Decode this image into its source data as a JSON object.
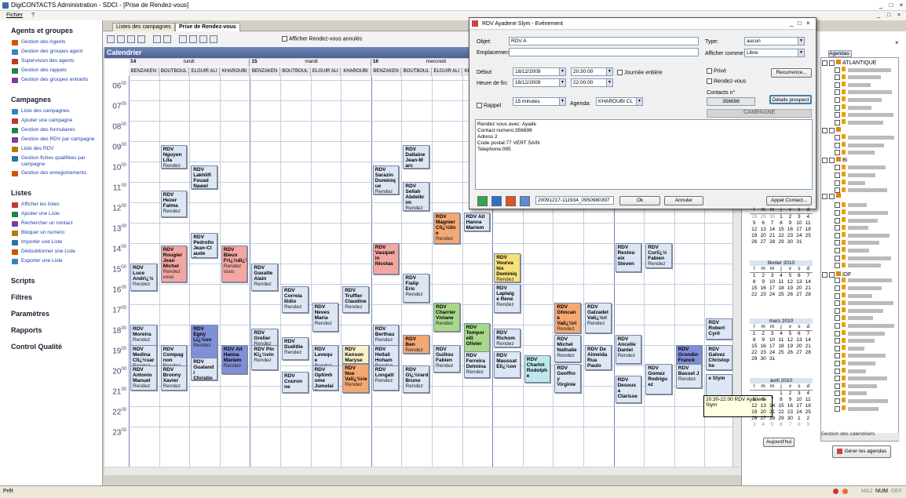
{
  "window": {
    "title": "DigiCONTACTS Administration - SDCI - [Prise de Rendez-vous]"
  },
  "menu": {
    "file": "Fichier",
    "help": "?"
  },
  "sidebar": {
    "sections": [
      {
        "title": "Agents et groupes",
        "items": [
          "Gestion des Agents",
          "Gestion des groupes agent",
          "Supervision des agents",
          "Gestion des rappels",
          "Gestion des groupes entrants"
        ]
      },
      {
        "title": "Campagnes",
        "items": [
          "Liste des campagnes",
          "Ajouter une campagne",
          "Gestion des formulaires",
          "Gestion des RDV par campagne",
          "Liste des RDV",
          "Gestion fiches qualifiées par campagne",
          "Gestion des enregistrements"
        ]
      },
      {
        "title": "Listes",
        "items": [
          "Afficher les listes",
          "Ajouter une Liste",
          "Rechercher un contact",
          "Bloquer un numéro",
          "Importer une Liste",
          "Dédoublonner une Liste",
          "Exporter une Liste"
        ]
      }
    ],
    "other": [
      "Scripts",
      "Filtres",
      "Paramètres",
      "Rapports",
      "Control Qualité"
    ]
  },
  "tabs": [
    "Listes des campagnes",
    "Prise de Rendez-vous"
  ],
  "toolbar": {
    "show_cancelled": "Afficher Rendez-vous annulés"
  },
  "calendar": {
    "title": "Calendrier",
    "days": [
      {
        "num": "14",
        "name": "lundi"
      },
      {
        "num": "15",
        "name": "mardi"
      },
      {
        "num": "16",
        "name": "mercredi"
      }
    ],
    "agents": [
      "BENZAKEN",
      "BOUTBOUL",
      "ELGUIR ALI",
      "KHAROUBI",
      "BENZAKEN",
      "BOUTBOUL",
      "ELGUIR ALI",
      "KHAROUBI",
      "BENZAKEN",
      "BOUTBOUL",
      "ELGUIR ALI",
      "KHAROUBI",
      "",
      "",
      "",
      "",
      "",
      "",
      ""
    ],
    "hours": [
      "06",
      "07",
      "08",
      "09",
      "10",
      "11",
      "12",
      "13",
      "14",
      "15",
      "16",
      "17",
      "18",
      "19",
      "20",
      "21",
      "22",
      "23"
    ],
    "events": [
      {
        "c": 1,
        "h": 9.0,
        "d": 1.2,
        "t": "RDV Nguyen Lita",
        "s": "Rendez",
        "col": "#dce6f4"
      },
      {
        "c": 2,
        "h": 10.0,
        "d": 1.2,
        "t": "RDV Lakhlifi Fouad Nawel",
        "s": "Rendez",
        "col": "#dce6f4"
      },
      {
        "c": 1,
        "h": 11.2,
        "d": 1.4,
        "t": "RDV Hezer Fatma",
        "s": "Rendez",
        "col": "#dce6f4"
      },
      {
        "c": 2,
        "h": 13.3,
        "d": 1.3,
        "t": "RDV Pedrollo Jean-Cl aude",
        "s": "Rendez",
        "col": "#dce6f4"
      },
      {
        "c": 1,
        "h": 13.9,
        "d": 1.9,
        "t": "RDV Rougier Jean Michel",
        "s": "Rendez vous",
        "col": "#f4a6a0"
      },
      {
        "c": 3,
        "h": 13.9,
        "d": 1.9,
        "t": "RDV Bieux Frï¿½dï¿½ric",
        "s": "Rendez vous",
        "col": "#f4a6a0"
      },
      {
        "c": 0,
        "h": 14.8,
        "d": 1.4,
        "t": "RDV Luce Andrï¿½",
        "s": "Rendez",
        "col": "#dce6f4"
      },
      {
        "c": 4,
        "h": 14.8,
        "d": 1.4,
        "t": "RDV Gaxatte Alain",
        "s": "Rendez",
        "col": "#dce6f4"
      },
      {
        "c": 5,
        "h": 15.9,
        "d": 1.4,
        "t": "RDV Correia Ilidio",
        "s": "Rendez",
        "col": "#dce6f4"
      },
      {
        "c": 7,
        "h": 15.9,
        "d": 1.4,
        "t": "RDV Truffier Claudine",
        "s": "Rendez",
        "col": "#dce6f4"
      },
      {
        "c": 6,
        "h": 16.7,
        "d": 1.5,
        "t": "RDV Neves Maria",
        "s": "Rendez",
        "col": "#dce6f4"
      },
      {
        "c": 0,
        "h": 17.8,
        "d": 1.1,
        "t": "RDV Moreira",
        "s": "Rendez",
        "col": "#dce6f4"
      },
      {
        "c": 2,
        "h": 17.8,
        "d": 1.8,
        "t": "RDV Egny Lï¿½on",
        "s": "Rendez",
        "col": "#7f8fd8"
      },
      {
        "c": 4,
        "h": 18.0,
        "d": 1.0,
        "t": "RDV Grelier",
        "s": "Rendez",
        "col": "#dce6f4"
      },
      {
        "c": 0,
        "h": 18.8,
        "d": 1.3,
        "t": "RDV Medina Clï¿½sar",
        "s": "Rendez",
        "col": "#dce6f4"
      },
      {
        "c": 1,
        "h": 18.8,
        "d": 1.3,
        "t": "RDV Compag non",
        "s": "Rendez",
        "col": "#dce6f4"
      },
      {
        "c": 3,
        "h": 18.8,
        "d": 1.5,
        "t": "RDV Ait Hanna Mariem",
        "s": "Rendez",
        "col": "#7f8fd8"
      },
      {
        "c": 4,
        "h": 18.8,
        "d": 1.3,
        "t": "RDV Pin Kï¿½vin",
        "s": "Rendez",
        "col": "#dce6f4"
      },
      {
        "c": 5,
        "h": 18.4,
        "d": 1.2,
        "t": "RDV Duditlie",
        "s": "Rendez",
        "col": "#dce6f4"
      },
      {
        "c": 2,
        "h": 19.4,
        "d": 1.2,
        "t": "RDV Gualand i Christin",
        "s": "Rendez",
        "col": "#dce6f4"
      },
      {
        "c": 0,
        "h": 19.8,
        "d": 1.3,
        "t": "RDV Antonio Manuel",
        "s": "Rendez",
        "col": "#dce6f4"
      },
      {
        "c": 1,
        "h": 19.8,
        "d": 1.3,
        "t": "RDV Bronny Xavier",
        "s": "Rendez",
        "col": "#dce6f4"
      },
      {
        "c": 5,
        "h": 20.1,
        "d": 1.1,
        "t": "RDV Couron ne",
        "s": "",
        "col": "#dce6f4"
      },
      {
        "c": 6,
        "h": 18.8,
        "d": 1.4,
        "t": "RDV Levequ e",
        "s": "Rendez",
        "col": "#dce6f4"
      },
      {
        "c": 6,
        "h": 19.8,
        "d": 1.3,
        "t": "RDV Optimh ome Jumelai",
        "s": "Rendez",
        "col": "#dce6f4"
      },
      {
        "c": 7,
        "h": 18.8,
        "d": 1.0,
        "t": "RDV Kenson Maryse",
        "s": "",
        "col": "#f7f0c8"
      },
      {
        "c": 7,
        "h": 19.7,
        "d": 1.5,
        "t": "RDV Noe Valï¿½rie",
        "s": "Rendez",
        "col": "#f4a872"
      },
      {
        "c": 8,
        "h": 10.0,
        "d": 1.5,
        "t": "RDV Sarazin Dominiq ue",
        "s": "Rendez",
        "col": "#dce6f4"
      },
      {
        "c": 9,
        "h": 9.0,
        "d": 1.2,
        "t": "RDV Dallaine Jean-M arc",
        "s": "",
        "col": "#dce6f4"
      },
      {
        "c": 9,
        "h": 10.8,
        "d": 1.5,
        "t": "RDV Sellah Abdelkr im",
        "s": "Rendez",
        "col": "#dce6f4"
      },
      {
        "c": 10,
        "h": 12.3,
        "d": 1.6,
        "t": "RDV Magnier Clï¿½lin e",
        "s": "Rendez",
        "col": "#f4a872"
      },
      {
        "c": 11,
        "h": 12.3,
        "d": 1.0,
        "t": "RDV Ait Hanna Mariem",
        "s": "Rendez",
        "col": "#dce6f4"
      },
      {
        "c": 8,
        "h": 13.8,
        "d": 1.6,
        "t": "RDV Vauquel in Nicolas",
        "s": "",
        "col": "#f4a6a0"
      },
      {
        "c": 9,
        "h": 15.3,
        "d": 1.5,
        "t": "RDV Fialip Eric",
        "s": "Rendez",
        "col": "#dce6f4"
      },
      {
        "c": 10,
        "h": 16.7,
        "d": 1.5,
        "t": "RDV Charrier Viviane",
        "s": "Rendez",
        "col": "#a8d88a"
      },
      {
        "c": 11,
        "h": 17.7,
        "d": 1.5,
        "t": "RDV Tempor elli Olivier",
        "s": "",
        "col": "#a8d88a"
      },
      {
        "c": 8,
        "h": 17.8,
        "d": 1.4,
        "t": "RDV Berthau",
        "s": "Rendez",
        "col": "#dce6f4"
      },
      {
        "c": 9,
        "h": 18.3,
        "d": 1.0,
        "t": "RDV Ben",
        "s": "Rendez",
        "col": "#f4a872"
      },
      {
        "c": 8,
        "h": 18.8,
        "d": 1.4,
        "t": "RDV Hellali Hoham",
        "s": "Rendez",
        "col": "#dce6f4"
      },
      {
        "c": 10,
        "h": 18.8,
        "d": 1.4,
        "t": "RDV Guillou Fabien",
        "s": "Rendez",
        "col": "#dce6f4"
      },
      {
        "c": 11,
        "h": 19.1,
        "d": 1.4,
        "t": "RDV Ferreira Delmina",
        "s": "Rendez",
        "col": "#dce6f4"
      },
      {
        "c": 8,
        "h": 19.8,
        "d": 1.3,
        "t": "RDV Longatt",
        "s": "Rendez",
        "col": "#dce6f4"
      },
      {
        "c": 9,
        "h": 19.8,
        "d": 1.4,
        "t": "RDV Gï¿½rard Bruno",
        "s": "Rendez",
        "col": "#dce6f4"
      },
      {
        "c": 12,
        "h": 14.3,
        "d": 1.5,
        "t": "RDV Vourva his Dominiq",
        "s": "Rendez",
        "col": "#f7e27a"
      },
      {
        "c": 12,
        "h": 15.8,
        "d": 1.5,
        "t": "RDV Laplaig e Rene",
        "s": "Rendez",
        "col": "#dce6f4"
      },
      {
        "c": 12,
        "h": 18.0,
        "d": 1.0,
        "t": "RDV Richom",
        "s": "Rendez",
        "col": "#dce6f4"
      },
      {
        "c": 12,
        "h": 19.1,
        "d": 1.4,
        "t": "RDV Maussat Elï¿½on",
        "s": "",
        "col": "#dce6f4"
      },
      {
        "c": 13,
        "h": 19.3,
        "d": 1.4,
        "t": "RDV Charlot Rodolph e",
        "s": "",
        "col": "#bfe8ee"
      },
      {
        "c": 14,
        "h": 16.7,
        "d": 1.6,
        "t": "RDV Ghocan e Valï¿½ri",
        "s": "Rendez",
        "col": "#f4a872"
      },
      {
        "c": 15,
        "h": 16.7,
        "d": 1.6,
        "t": "RDV Galzadet Valï¿½ri",
        "s": "Rendez",
        "col": "#dce6f4"
      },
      {
        "c": 14,
        "h": 18.3,
        "d": 1.4,
        "t": "RDV Michel Nathalie",
        "s": "Rendez",
        "col": "#dce6f4"
      },
      {
        "c": 15,
        "h": 18.8,
        "d": 1.3,
        "t": "RDV De Almeida Rua Paulo",
        "s": "",
        "col": "#dce6f4"
      },
      {
        "c": 14,
        "h": 19.7,
        "d": 1.5,
        "t": "RDV Geoffro y Virginie",
        "s": "",
        "col": "#dce6f4"
      },
      {
        "c": 16,
        "h": 13.8,
        "d": 1.5,
        "t": "RDV Restou eix Steven",
        "s": "",
        "col": "#dce6f4"
      },
      {
        "c": 17,
        "h": 13.8,
        "d": 1.3,
        "t": "RDV Curiï¿½ Fabien",
        "s": "Rendez",
        "col": "#dce6f4"
      },
      {
        "c": 16,
        "h": 18.3,
        "d": 1.5,
        "t": "RDV Ancelle Daniel",
        "s": "Rendez",
        "col": "#dce6f4"
      },
      {
        "c": 16,
        "h": 20.3,
        "d": 1.4,
        "t": "RDV Desous a Clarisse",
        "s": "",
        "col": "#dce6f4"
      },
      {
        "c": 17,
        "h": 19.7,
        "d": 1.6,
        "t": "RDV Gomez Rodrigu ez",
        "s": "",
        "col": "#dce6f4"
      },
      {
        "c": 18,
        "h": 18.8,
        "d": 1.0,
        "t": "RDV Grondin Franck",
        "s": "",
        "col": "#7f8fd8"
      },
      {
        "c": 18,
        "h": 19.7,
        "d": 1.3,
        "t": "RDV Basset J",
        "s": "Rendez",
        "col": "#dce6f4"
      },
      {
        "c": 19,
        "h": 17.5,
        "d": 1.1,
        "t": "RDV Robert Cyril",
        "s": "",
        "col": "#dce6f4"
      },
      {
        "c": 19,
        "h": 18.8,
        "d": 1.3,
        "t": "RDV Galvez Christop he",
        "s": "",
        "col": "#dce6f4"
      },
      {
        "c": 19,
        "h": 20.2,
        "d": 1.6,
        "t": "e Slym",
        "s": "",
        "col": "#dce6f4"
      }
    ]
  },
  "tooltip": "20:30-22:00 RDV Ayadene Slym",
  "dialog": {
    "title": "RDV Ayadene Slym - Evénement",
    "objet_label": "Objet:",
    "objet_value": "RDV A",
    "emplacement_label": "Emplacement:",
    "debut_label": "Début:",
    "debut_date": "18/12/2009",
    "debut_time": "20:30:00",
    "fin_label": "Heure de fin:",
    "fin_date": "18/12/2009",
    "fin_time": "22:00:00",
    "allday": "Journée entière",
    "rappel": "Rappel",
    "rappel_value": "15 minutes",
    "agenda_label": "Agenda:",
    "agenda_value": "KHAROUBI CL",
    "type_label": "Type:",
    "type_value": "aucun",
    "afficher_label": "Afficher comme:",
    "afficher_value": "Libre",
    "prive": "Privé",
    "rdv": "Rendez-vous",
    "recurrence": "Recurrence...",
    "contacts_label": "Contacts n°",
    "contacts_value": "356698",
    "details": "Détails prospect",
    "campagne": "CAMPAGNE",
    "notes": [
      "Rendez vous avec: Ayade",
      "Contact numero:356698",
      "Adress 2",
      "Code postal:77  VERT SAIN",
      "Telephone:095"
    ],
    "rec_value": "20091217-111934_0950980397",
    "ok": "Ok",
    "annuler": "Annuler",
    "appel": "Appel Contact..."
  },
  "right": {
    "agendas_tab": "Agendas",
    "groups": [
      "ATLANTIQUE",
      "",
      "Bi",
      "",
      "IDF"
    ],
    "months": [
      {
        "name": "",
        "days": [
          "l",
          "m",
          "m",
          "j",
          "v",
          "s",
          "d"
        ],
        "rows": [
          [
            "28",
            "29",
            "30",
            "1",
            "2",
            "3",
            "4"
          ],
          [
            "5",
            "6",
            "7",
            "8",
            "9",
            "10",
            "11"
          ],
          [
            "12",
            "13",
            "14",
            "15",
            "16",
            "17",
            "18"
          ],
          [
            "19",
            "20",
            "21",
            "22",
            "23",
            "24",
            "25"
          ],
          [
            "26",
            "27",
            "28",
            "29",
            "30",
            "31",
            ""
          ]
        ]
      },
      {
        "name": "février 2010",
        "days": [
          "l",
          "m",
          "m",
          "j",
          "v",
          "s",
          "d"
        ],
        "rows": [
          [
            "1",
            "2",
            "3",
            "4",
            "5",
            "6",
            "7"
          ],
          [
            "8",
            "9",
            "10",
            "11",
            "12",
            "13",
            "14"
          ],
          [
            "15",
            "16",
            "17",
            "18",
            "19",
            "20",
            "21"
          ],
          [
            "22",
            "23",
            "24",
            "25",
            "26",
            "27",
            "28"
          ]
        ]
      },
      {
        "name": "mars 2010",
        "days": [
          "l",
          "m",
          "m",
          "j",
          "v",
          "s",
          "d"
        ],
        "rows": [
          [
            "1",
            "2",
            "3",
            "4",
            "5",
            "6",
            "7"
          ],
          [
            "8",
            "9",
            "10",
            "11",
            "12",
            "13",
            "14"
          ],
          [
            "15",
            "16",
            "17",
            "18",
            "19",
            "20",
            "21"
          ],
          [
            "22",
            "23",
            "24",
            "25",
            "26",
            "27",
            "28"
          ],
          [
            "29",
            "30",
            "31",
            "",
            "",
            "",
            ""
          ]
        ]
      },
      {
        "name": "avril 2010",
        "days": [
          "l",
          "m",
          "m",
          "j",
          "v",
          "s",
          "d"
        ],
        "rows": [
          [
            "",
            "",
            "",
            "1",
            "2",
            "3",
            "4"
          ],
          [
            "5",
            "6",
            "7",
            "8",
            "9",
            "10",
            "11"
          ],
          [
            "12",
            "13",
            "14",
            "15",
            "16",
            "17",
            "18"
          ],
          [
            "19",
            "20",
            "21",
            "22",
            "23",
            "24",
            "25"
          ],
          [
            "26",
            "27",
            "28",
            "29",
            "30",
            "1",
            "2"
          ],
          [
            "3",
            "4",
            "5",
            "6",
            "7",
            "8",
            "9"
          ]
        ]
      }
    ],
    "today": "Aujourd'hui",
    "gestion_title": "Gestion des calendriers",
    "gerer": "Gérer les agendas"
  },
  "status": {
    "left": "Prêt",
    "maj": "MAJ",
    "num": "NUM",
    "def": "DEF"
  }
}
